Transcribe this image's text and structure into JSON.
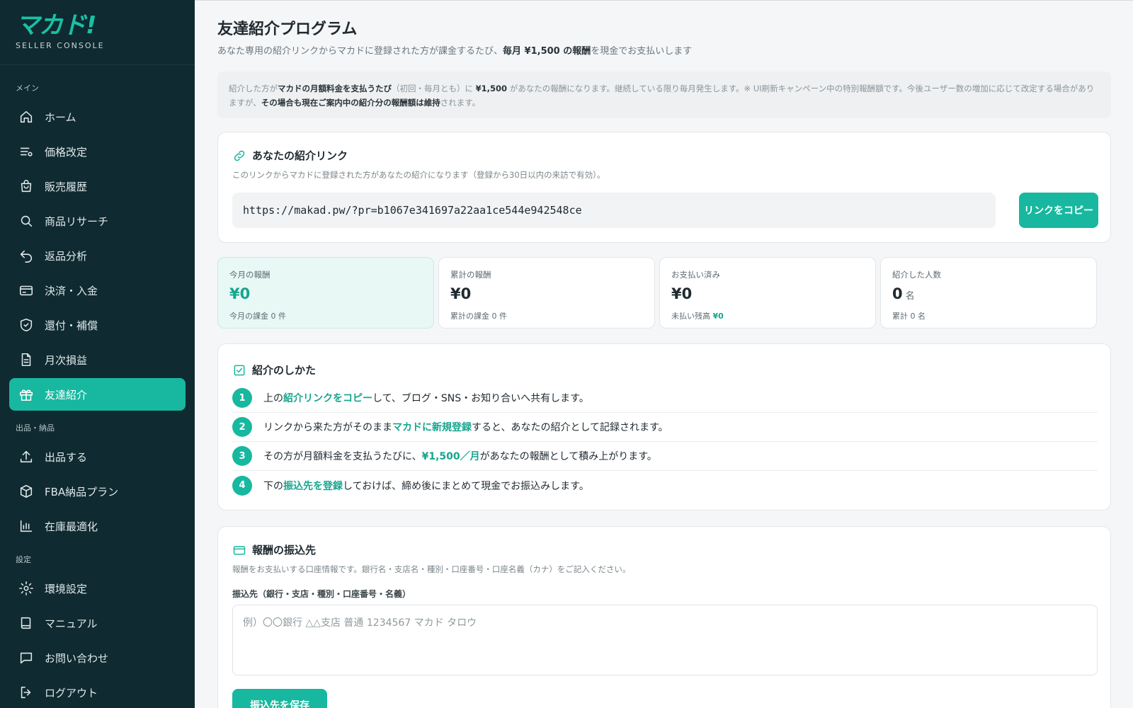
{
  "brand": {
    "logo": "マカド!",
    "subtitle": "SELLER CONSOLE"
  },
  "sidebar": {
    "sections": [
      {
        "label": "メイン",
        "items": [
          {
            "label": "ホーム",
            "icon": "home-icon"
          },
          {
            "label": "価格改定",
            "icon": "price-list-icon"
          },
          {
            "label": "販売履歴",
            "icon": "shopping-bag-icon"
          },
          {
            "label": "商品リサーチ",
            "icon": "search-icon"
          },
          {
            "label": "返品分析",
            "icon": "return-icon"
          },
          {
            "label": "決済・入金",
            "icon": "credit-card-icon"
          },
          {
            "label": "還付・補償",
            "icon": "shield-check-icon"
          },
          {
            "label": "月次損益",
            "icon": "document-icon"
          },
          {
            "label": "友達紹介",
            "icon": "gift-icon",
            "active": true
          }
        ]
      },
      {
        "label": "出品・納品",
        "items": [
          {
            "label": "出品する",
            "icon": "upload-icon"
          },
          {
            "label": "FBA納品プラン",
            "icon": "package-icon"
          },
          {
            "label": "在庫最適化",
            "icon": "bar-chart-icon"
          }
        ]
      },
      {
        "label": "設定",
        "items": [
          {
            "label": "環境設定",
            "icon": "gear-icon"
          },
          {
            "label": "マニュアル",
            "icon": "book-icon"
          },
          {
            "label": "お問い合わせ",
            "icon": "chat-icon"
          },
          {
            "label": "ログアウト",
            "icon": "logout-icon"
          }
        ]
      }
    ]
  },
  "page": {
    "title": "友達紹介プログラム",
    "subtitle_pre": "あなた専用の紹介リンクからマカドに登録された方が課金するたび、",
    "subtitle_bold": "毎月 ¥1,500 の報酬",
    "subtitle_post": "を現金でお支払いします"
  },
  "notice": {
    "p1": "紹介した方が",
    "b1": "マカドの月額料金を支払うたび",
    "p2": "（初回・毎月とも）に ",
    "b2": "¥1,500",
    "p3": " があなたの報酬になります。継続している限り毎月発生します。※ UI刷新キャンペーン中の特別報酬額です。今後ユーザー数の増加に応じて改定する場合がありますが、",
    "b3": "その場合も現在ご案内中の紹介分の報酬額は維持",
    "p4": "されます。"
  },
  "link_card": {
    "title": "あなたの紹介リンク",
    "desc": "このリンクからマカドに登録された方があなたの紹介になります（登録から30日以内の来訪で有効）。",
    "url": "https://makad.pw/?pr=b1067e341697a22aa1ce544e942548ce",
    "copy_label": "リンクをコピー"
  },
  "stats": [
    {
      "label": "今月の報酬",
      "value": "¥0",
      "unit": "",
      "note": "今月の課金 0 件",
      "note_hl": ""
    },
    {
      "label": "累計の報酬",
      "value": "¥0",
      "unit": "",
      "note": "累計の課金 0 件",
      "note_hl": ""
    },
    {
      "label": "お支払い済み",
      "value": "¥0",
      "unit": "",
      "note": "未払い残高 ",
      "note_hl": "¥0"
    },
    {
      "label": "紹介した人数",
      "value": "0",
      "unit": "名",
      "note": "累計 0 名",
      "note_hl": ""
    }
  ],
  "howto": {
    "title": "紹介のしかた",
    "steps": [
      {
        "num": "1",
        "pre": "上の",
        "hl": "紹介リンクをコピー",
        "post": "して、ブログ・SNS・お知り合いへ共有します。"
      },
      {
        "num": "2",
        "pre": "リンクから来た方がそのまま",
        "hl": "マカドに新規登録",
        "post": "すると、あなたの紹介として記録されます。"
      },
      {
        "num": "3",
        "pre": "その方が月額料金を支払うたびに、",
        "hl": "¥1,500／月",
        "post": "があなたの報酬として積み上がります。"
      },
      {
        "num": "4",
        "pre": "下の",
        "hl": "振込先を登録",
        "post": "しておけば、締め後にまとめて現金でお振込みします。"
      }
    ]
  },
  "bank": {
    "title": "報酬の振込先",
    "desc": "報酬をお支払いする口座情報です。銀行名・支店名・種別・口座番号・口座名義（カナ）をご記入ください。",
    "field_label": "振込先（銀行・支店・種別・口座番号・名義）",
    "placeholder": "例）〇〇銀行 △△支店 普通 1234567 マカド タロウ",
    "value": "",
    "save_label": "振込先を保存"
  },
  "colors": {
    "accent": "#17b89f",
    "sidebar": "#0f2a30"
  }
}
